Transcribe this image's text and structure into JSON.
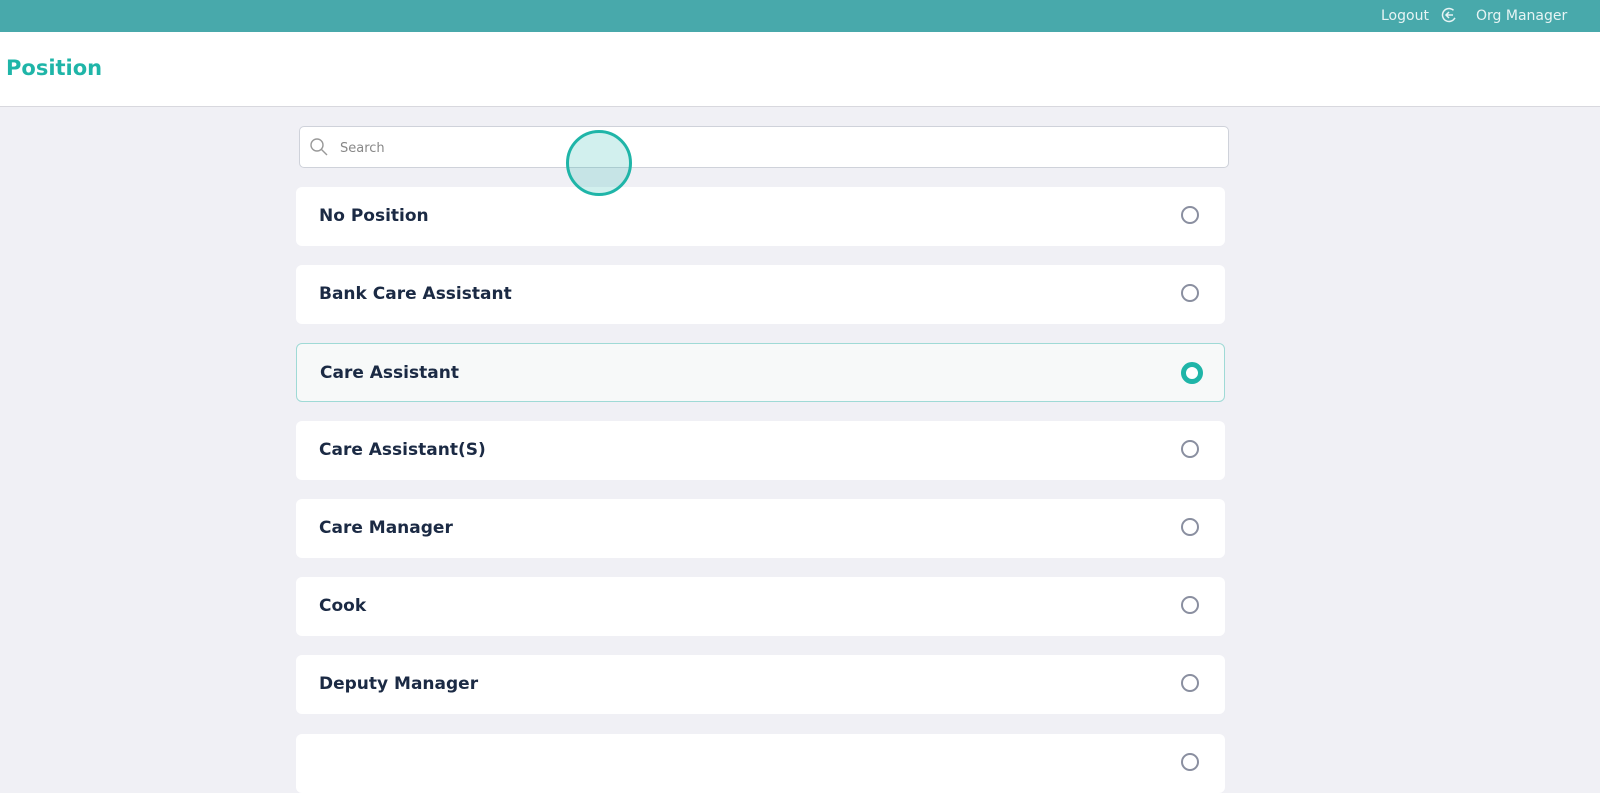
{
  "topbar": {
    "logout_label": "Logout",
    "user_label": "Org Manager"
  },
  "header": {
    "title": "Position"
  },
  "search": {
    "placeholder": "Search",
    "value": ""
  },
  "positions": [
    {
      "label": "No Position",
      "selected": false
    },
    {
      "label": "Bank Care Assistant",
      "selected": false
    },
    {
      "label": "Care Assistant",
      "selected": true
    },
    {
      "label": "Care Assistant(S)",
      "selected": false
    },
    {
      "label": "Care Manager",
      "selected": false
    },
    {
      "label": "Cook",
      "selected": false
    },
    {
      "label": "Deputy Manager",
      "selected": false
    }
  ],
  "colors": {
    "accent": "#1fb5a8",
    "topbar": "#48a9ab"
  }
}
